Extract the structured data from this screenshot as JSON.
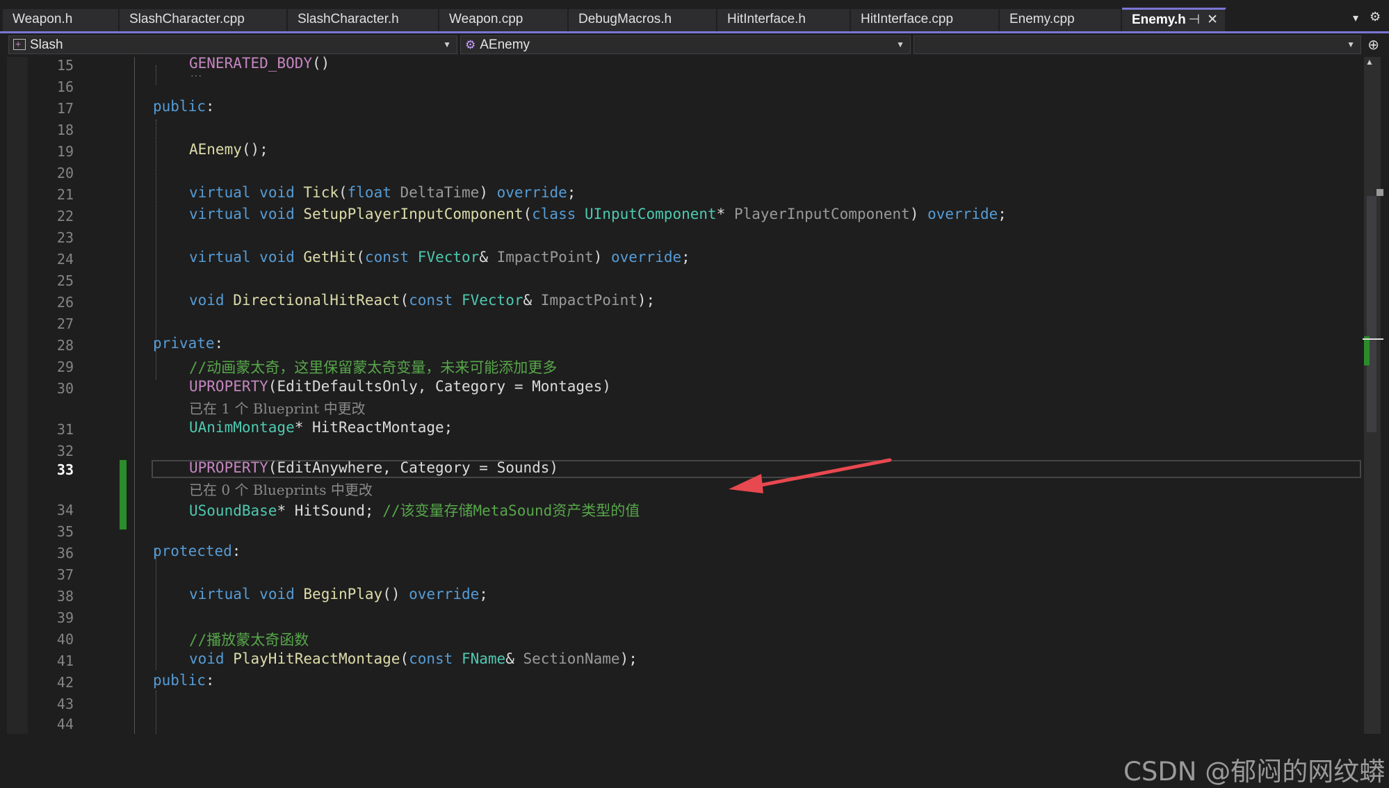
{
  "tabs": [
    {
      "label": "Weapon.h"
    },
    {
      "label": "SlashCharacter.cpp"
    },
    {
      "label": "SlashCharacter.h"
    },
    {
      "label": "Weapon.cpp"
    },
    {
      "label": "DebugMacros.h"
    },
    {
      "label": "HitInterface.h"
    },
    {
      "label": "HitInterface.cpp"
    },
    {
      "label": "Enemy.cpp"
    },
    {
      "label": "Enemy.h",
      "active": true
    }
  ],
  "nav": {
    "project": "Slash",
    "class": "AEnemy",
    "member": ""
  },
  "editor": {
    "current_line": 33,
    "lines": [
      {
        "num": "15",
        "text": "GENERATED_BODY()"
      },
      {
        "num": "16",
        "text": ""
      },
      {
        "num": "17",
        "text": "public:"
      },
      {
        "num": "18",
        "text": ""
      },
      {
        "num": "19",
        "text": "AEnemy();"
      },
      {
        "num": "20",
        "text": ""
      },
      {
        "num": "21",
        "text": "virtual void Tick(float DeltaTime) override;"
      },
      {
        "num": "22",
        "text": "virtual void SetupPlayerInputComponent(class UInputComponent* PlayerInputComponent) override;"
      },
      {
        "num": "23",
        "text": ""
      },
      {
        "num": "24",
        "text": "virtual void GetHit(const FVector& ImpactPoint) override;"
      },
      {
        "num": "25",
        "text": ""
      },
      {
        "num": "26",
        "text": "void DirectionalHitReact(const FVector& ImpactPoint);"
      },
      {
        "num": "27",
        "text": ""
      },
      {
        "num": "28",
        "text": "private:"
      },
      {
        "num": "29",
        "text": "//动画蒙太奇，这里保留蒙太奇变量，未来可能添加更多"
      },
      {
        "num": "30",
        "text": "UPROPERTY(EditDefaultsOnly, Category = Montages)"
      },
      {
        "hint": "已在 1 个 Blueprint 中更改"
      },
      {
        "num": "31",
        "text": "UAnimMontage* HitReactMontage;"
      },
      {
        "num": "32",
        "text": ""
      },
      {
        "num": "33",
        "text": "UPROPERTY(EditAnywhere, Category = Sounds)"
      },
      {
        "hint": "已在 0 个 Blueprints 中更改"
      },
      {
        "num": "34",
        "text": "USoundBase* HitSound; //该变量存储MetaSound资产类型的值"
      },
      {
        "num": "35",
        "text": ""
      },
      {
        "num": "36",
        "text": "protected:"
      },
      {
        "num": "37",
        "text": ""
      },
      {
        "num": "38",
        "text": "virtual void BeginPlay() override;"
      },
      {
        "num": "39",
        "text": ""
      },
      {
        "num": "40",
        "text": "//播放蒙太奇函数"
      },
      {
        "num": "41",
        "text": "void PlayHitReactMontage(const FName& SectionName);"
      },
      {
        "num": "42",
        "text": "public:"
      },
      {
        "num": "43",
        "text": ""
      },
      {
        "num": "44",
        "text": ""
      }
    ]
  },
  "colors": {
    "accent": "#7a76d6",
    "keyword": "#569cd6",
    "macro": "#c586c0",
    "function": "#dcdcaa",
    "type": "#4ec9b0",
    "comment": "#57a64a",
    "annotation_arrow": "#e8484f"
  },
  "icons": [
    "pin-icon",
    "close-icon",
    "tab-overflow-icon",
    "settings-gear-icon",
    "project-icon",
    "class-icon",
    "split-editor-icon"
  ],
  "watermark": "CSDN @郁闷的网纹蟒"
}
